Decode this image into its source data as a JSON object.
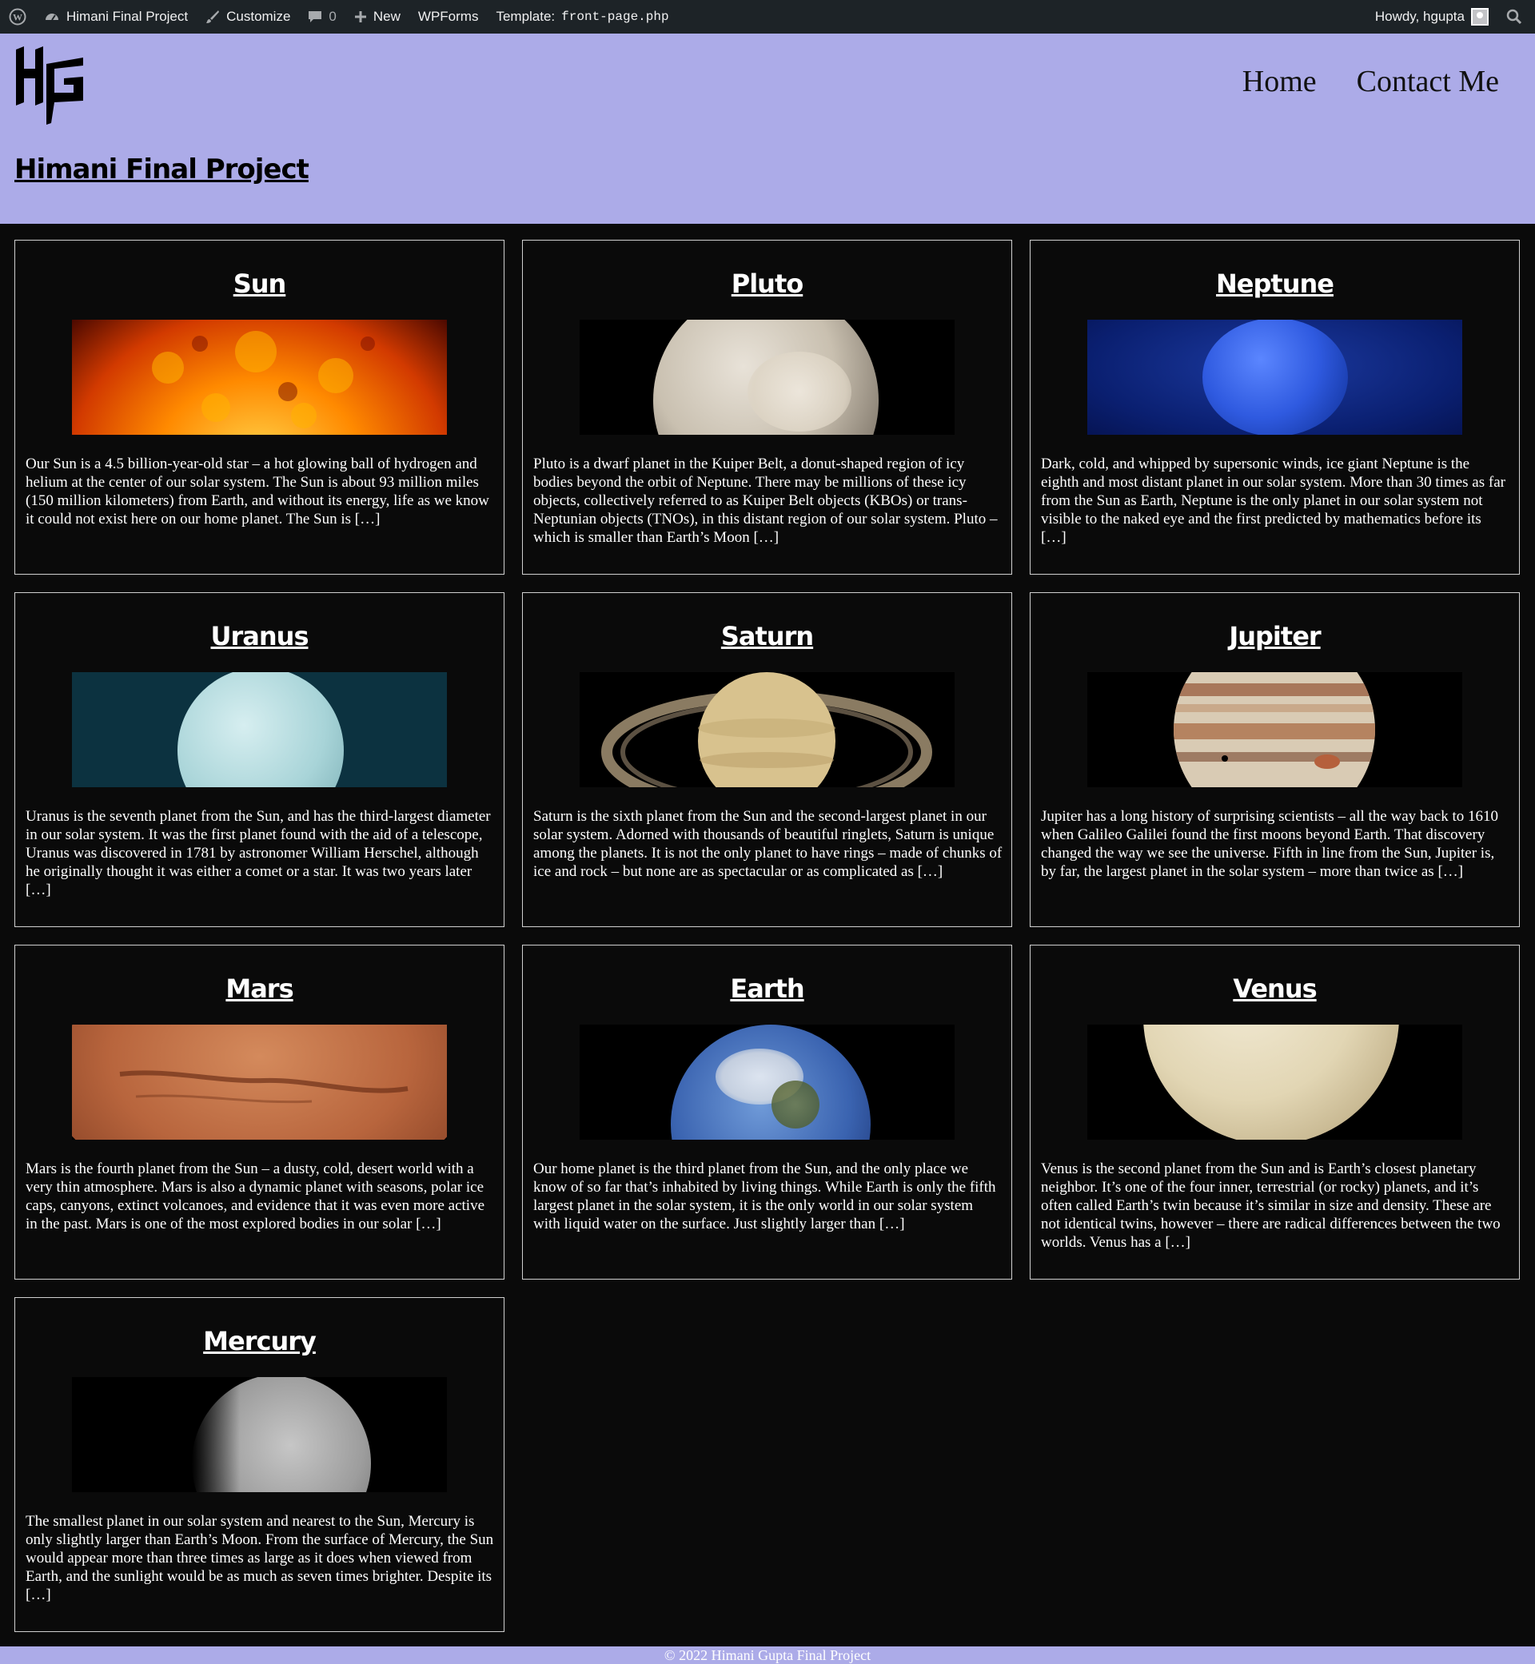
{
  "adminbar": {
    "site_name": "Himani Final Project",
    "customize": "Customize",
    "comments_count": "0",
    "new": "New",
    "wpforms": "WPForms",
    "template_label": "Template:",
    "template_file": "front-page.php",
    "howdy": "Howdy, hgupta"
  },
  "header": {
    "site_title": "Himani Final Project",
    "logo_text": "HG",
    "nav": [
      "Home",
      "Contact Me"
    ]
  },
  "planets": [
    {
      "title": "Sun",
      "excerpt": "Our Sun is a 4.5 billion-year-old star – a hot glowing ball of hydrogen and helium at the center of our solar system. The Sun is about 93 million miles (150 million kilometers) from Earth, and without its energy, life as we know it could not exist here on our home planet. The Sun is […]"
    },
    {
      "title": "Pluto",
      "excerpt": "Pluto is a dwarf planet in the Kuiper Belt, a donut-shaped region of icy bodies beyond the orbit of Neptune. There may be millions of these icy objects, collectively referred to as Kuiper Belt objects (KBOs) or trans-Neptunian objects (TNOs), in this distant region of our solar system. Pluto – which is smaller than Earth’s Moon […]"
    },
    {
      "title": "Neptune",
      "excerpt": "Dark, cold, and whipped by supersonic winds, ice giant Neptune is the eighth and most distant planet in our solar system. More than 30 times as far from the Sun as Earth, Neptune is the only planet in our solar system not visible to the naked eye and the first predicted by mathematics before its […]"
    },
    {
      "title": "Uranus",
      "excerpt": "Uranus is the seventh planet from the Sun, and has the third-largest diameter in our solar system. It was the first planet found with the aid of a telescope, Uranus was discovered in 1781 by astronomer William Herschel, although he originally thought it was either a comet or a star. It was two years later […]"
    },
    {
      "title": "Saturn",
      "excerpt": "Saturn is the sixth planet from the Sun and the second-largest planet in our solar system. Adorned with thousands of beautiful ringlets, Saturn is unique among the planets. It is not the only planet to have rings – made of chunks of ice and rock – but none are as spectacular or as complicated as […]"
    },
    {
      "title": "Jupiter",
      "excerpt": "Jupiter has a long history of surprising scientists – all the way back to 1610 when Galileo Galilei found the first moons beyond Earth. That discovery changed the way we see the universe. Fifth in line from the Sun, Jupiter is, by far, the largest planet in the solar system – more than twice as […]"
    },
    {
      "title": "Mars",
      "excerpt": "Mars is the fourth planet from the Sun – a dusty, cold, desert world with a very thin atmosphere. Mars is also a dynamic planet with seasons, polar ice caps, canyons, extinct volcanoes, and evidence that it was even more active in the past. Mars is one of the most explored bodies in our solar […]"
    },
    {
      "title": "Earth",
      "excerpt": "Our home planet is the third planet from the Sun, and the only place we know of so far that’s inhabited by living things. While Earth is only the fifth largest planet in the solar system, it is the only world in our solar system with liquid water on the surface. Just slightly larger than […]"
    },
    {
      "title": "Venus",
      "excerpt": "Venus is the second planet from the Sun and is Earth’s closest planetary neighbor. It’s one of the four inner, terrestrial (or rocky) planets, and it’s often called Earth’s twin because it’s similar in size and density. These are not identical twins, however – there are radical differences between the two worlds. Venus has a […]"
    },
    {
      "title": "Mercury",
      "excerpt": "The smallest planet in our solar system and nearest to the Sun, Mercury is only slightly larger than Earth’s Moon. From the surface of Mercury, the Sun would appear more than three times as large as it does when viewed from Earth, and the sunlight would be as much as seven times brighter. Despite its […]"
    }
  ],
  "footer": {
    "text": "© 2022 Himani Gupta Final Project"
  },
  "colors": {
    "header_bg": "#acabe8",
    "adminbar_bg": "#1d2327",
    "page_bg": "#0a0a0a"
  }
}
